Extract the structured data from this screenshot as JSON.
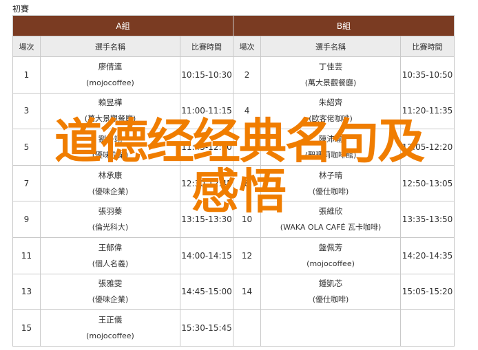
{
  "section": {
    "title": "初賽"
  },
  "groups": {
    "a": "A組",
    "b": "B組"
  },
  "headers": {
    "order": "場次",
    "player": "選手名稱",
    "time": "比賽時間"
  },
  "rows": [
    {
      "a": {
        "no": "1",
        "name": "廖倩連",
        "team": "(mojocoffee)",
        "time": "10:15-10:30"
      },
      "b": {
        "no": "2",
        "name": "丁佳芸",
        "team": "(萬大景觀餐廳)",
        "time": "10:35-10:50"
      }
    },
    {
      "a": {
        "no": "3",
        "name": "賴昱樺",
        "team": "(萬大景觀餐廳)",
        "time": "11:00-11:15"
      },
      "b": {
        "no": "4",
        "name": "朱紹齊",
        "team": "(歐客佬咖啡)",
        "time": "11:20-11:35"
      }
    },
    {
      "a": {
        "no": "5",
        "name": "劉子翊",
        "team": "(優味企業)",
        "time": "11:45-12:00"
      },
      "b": {
        "no": "6",
        "name": "陳沛瑜",
        "team": "(聖瑪莉咖啡館)",
        "time": "12:05-12:20"
      }
    },
    {
      "a": {
        "no": "7",
        "name": "林承康",
        "team": "(優味企業)",
        "time": "12:30-12:45"
      },
      "b": {
        "no": "8",
        "name": "林子晴",
        "team": "(優仕咖啡)",
        "time": "12:50-13:05"
      }
    },
    {
      "a": {
        "no": "9",
        "name": "張羽蓁",
        "team": "(倫光科大)",
        "time": "13:15-13:30"
      },
      "b": {
        "no": "10",
        "name": "張維欣",
        "team": "(WAKA OLA CAFÉ 瓦卡咖啡)",
        "time": "13:35-13:50"
      }
    },
    {
      "a": {
        "no": "11",
        "name": "王郁偉",
        "team": "(個人名義)",
        "time": "14:00-14:15"
      },
      "b": {
        "no": "12",
        "name": "盤佩芳",
        "team": "(mojocoffee)",
        "time": "14:20-14:35"
      }
    },
    {
      "a": {
        "no": "13",
        "name": "張雅雯",
        "team": "(優味企業)",
        "time": "14:45-15:00"
      },
      "b": {
        "no": "14",
        "name": "鍾凱芯",
        "team": "(優仕咖啡)",
        "time": "15:05-15:20"
      }
    },
    {
      "a": {
        "no": "15",
        "name": "王正儀",
        "team": "(mojocoffee)",
        "time": "15:30-15:45"
      },
      "b": {
        "no": "",
        "name": "",
        "team": "",
        "time": ""
      }
    }
  ],
  "overlay": {
    "line1": "道德经经典名句及",
    "line2": "感悟"
  },
  "colors": {
    "group_header_bg": "#7a3b22",
    "column_header_bg": "#ececec",
    "overlay_text": "#f07d00"
  }
}
